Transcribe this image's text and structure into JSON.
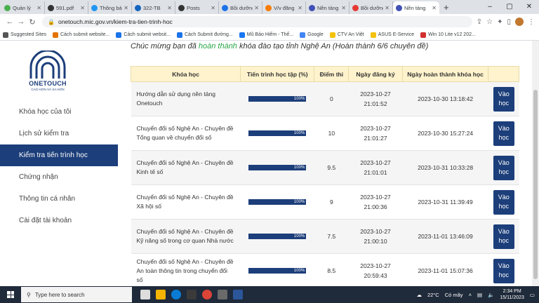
{
  "browser": {
    "tabs": [
      {
        "label": "Quản lý",
        "color": "#4caf50"
      },
      {
        "label": "591.pdf",
        "color": "#333333"
      },
      {
        "label": "Thông báo",
        "color": "#2196f3"
      },
      {
        "label": "322-TB",
        "color": "#1565c0"
      },
      {
        "label": "Posts",
        "color": "#333333"
      },
      {
        "label": "Bồi dưỡng",
        "color": "#1a73e8"
      },
      {
        "label": "V/v đăng",
        "color": "#f57c00"
      },
      {
        "label": "Nền tảng",
        "color": "#3f51b5"
      },
      {
        "label": "Bồi dưỡng",
        "color": "#e53935"
      },
      {
        "label": "Nền tảng",
        "color": "#3f51b5"
      }
    ],
    "new_tab": "+",
    "url": "onetouch.mic.gov.vn/kiem-tra-tien-trinh-hoc",
    "bookmarks": [
      {
        "label": "Suggested Sites",
        "color": "#555555"
      },
      {
        "label": "Cách submit website...",
        "color": "#e37400"
      },
      {
        "label": "Cách submit websit...",
        "color": "#1a73e8"
      },
      {
        "label": "Cách Submit đường...",
        "color": "#1a73e8"
      },
      {
        "label": "Mũ Bảo Hiểm - Thế...",
        "color": "#1877f2"
      },
      {
        "label": "Google",
        "color": "#4285f4"
      },
      {
        "label": "CTV An Việt",
        "color": "#f4c20d"
      },
      {
        "label": "ASUS E-Service",
        "color": "#f4c20d"
      },
      {
        "label": "Win 10 Lite v12 202...",
        "color": "#d32f2f"
      }
    ]
  },
  "logo": {
    "name": "ONETOUCH",
    "tagline": "CAO HƠN VÀ XA HƠN"
  },
  "sidebar": {
    "items": [
      {
        "label": "Khóa học của tôi"
      },
      {
        "label": "Lịch sử kiểm tra"
      },
      {
        "label": "Kiểm tra tiến trình học"
      },
      {
        "label": "Chứng nhận"
      },
      {
        "label": "Thông tin cá nhân"
      },
      {
        "label": "Cài đặt tài khoản"
      }
    ]
  },
  "main": {
    "congrats_prefix": "Chúc mừng bạn đã ",
    "congrats_highlight": "hoàn thành",
    "congrats_suffix": " khóa đào tạo tỉnh Nghệ An (Hoàn thành 6/6 chuyên đề)",
    "headers": [
      "Khóa học",
      "Tiến trình học tập (%)",
      "Điểm thi",
      "Ngày đăng ký",
      "Ngày hoàn thành khóa học",
      ""
    ],
    "rows": [
      {
        "course": "Hướng dẫn sử dụng nền tảng Onetouch",
        "progress": 100,
        "progress_label": "100%",
        "score": "0",
        "reg_date": "2023-10-27",
        "reg_time": "21:01:52",
        "done": "2023-10-30 13:18:42",
        "action": "Vào học"
      },
      {
        "course": "Chuyển đổi số Nghệ An - Chuyên đề Tổng quan về chuyển đổi số",
        "progress": 100,
        "progress_label": "100%",
        "score": "10",
        "reg_date": "2023-10-27",
        "reg_time": "21:01:27",
        "done": "2023-10-30 15:27:24",
        "action": "Vào học"
      },
      {
        "course": "Chuyển đổi số Nghệ An - Chuyên đề Kinh tế số",
        "progress": 100,
        "progress_label": "100%",
        "score": "9.5",
        "reg_date": "2023-10-27",
        "reg_time": "21:01:01",
        "done": "2023-10-31 10:33:28",
        "action": "Vào học"
      },
      {
        "course": "Chuyển đổi số Nghệ An - Chuyên đề Xã hội số",
        "progress": 100,
        "progress_label": "100%",
        "score": "9",
        "reg_date": "2023-10-27",
        "reg_time": "21:00:36",
        "done": "2023-10-31 11:39:49",
        "action": "Vào học"
      },
      {
        "course": "Chuyển đổi số Nghệ An - Chuyên đề Kỹ năng số trong cơ quan Nhà nước",
        "progress": 100,
        "progress_label": "100%",
        "score": "7.5",
        "reg_date": "2023-10-27",
        "reg_time": "21:00:10",
        "done": "2023-11-01 13:46:09",
        "action": "Vào học"
      },
      {
        "course": "Chuyển đổi số Nghệ An - Chuyên đề An toàn thông tin trong chuyển đổi số",
        "progress": 100,
        "progress_label": "100%",
        "score": "8.5",
        "reg_date": "2023-10-27",
        "reg_time": "20:59:43",
        "done": "2023-11-01 15:07:36",
        "action": "Vào học"
      }
    ]
  },
  "taskbar": {
    "search_placeholder": "Type here to search",
    "weather": "22°C",
    "weather_desc": "Có mây",
    "time": "2:34 PM",
    "date": "15/11/2023"
  }
}
